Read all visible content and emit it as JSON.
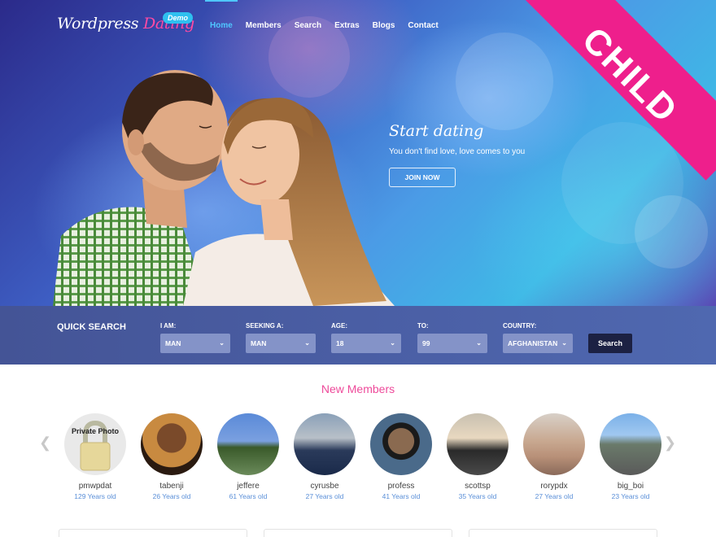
{
  "site": {
    "logo_part1": "Wordpress",
    "logo_part2": "Dating",
    "badge": "Demo",
    "ribbon": "CHILD"
  },
  "nav": {
    "items": [
      "Home",
      "Members",
      "Search",
      "Extras",
      "Blogs",
      "Contact"
    ],
    "active": "Home"
  },
  "hero": {
    "title": "Start dating",
    "subtitle": "You don't find love, love comes to you",
    "cta": "JOIN NOW"
  },
  "quick_search": {
    "title": "QUICK SEARCH",
    "fields": [
      {
        "label": "I AM:",
        "value": "MAN"
      },
      {
        "label": "SEEKING A:",
        "value": "MAN"
      },
      {
        "label": "AGE:",
        "value": "18"
      },
      {
        "label": "TO:",
        "value": "99"
      },
      {
        "label": "COUNTRY:",
        "value": "AFGHANISTAN"
      }
    ],
    "button": "Search"
  },
  "new_members": {
    "title": "New Members",
    "members": [
      {
        "name": "pmwpdat",
        "age": "129 Years old",
        "photo_text": "Private Photo"
      },
      {
        "name": "tabenji",
        "age": "26 Years old"
      },
      {
        "name": "jeffere",
        "age": "61 Years old"
      },
      {
        "name": "cyrusbe",
        "age": "27 Years old"
      },
      {
        "name": "profess",
        "age": "41 Years old"
      },
      {
        "name": "scottsp",
        "age": "35 Years old"
      },
      {
        "name": "rorypdx",
        "age": "27 Years old"
      },
      {
        "name": "big_boi",
        "age": "23 Years old"
      }
    ]
  },
  "colors": {
    "accent_pink": "#ee4a9a",
    "ribbon": "#ee1f8c",
    "nav_active": "#4fc7ff",
    "search_bar": "#4a5ea4",
    "age_text": "#5a8fd8"
  }
}
